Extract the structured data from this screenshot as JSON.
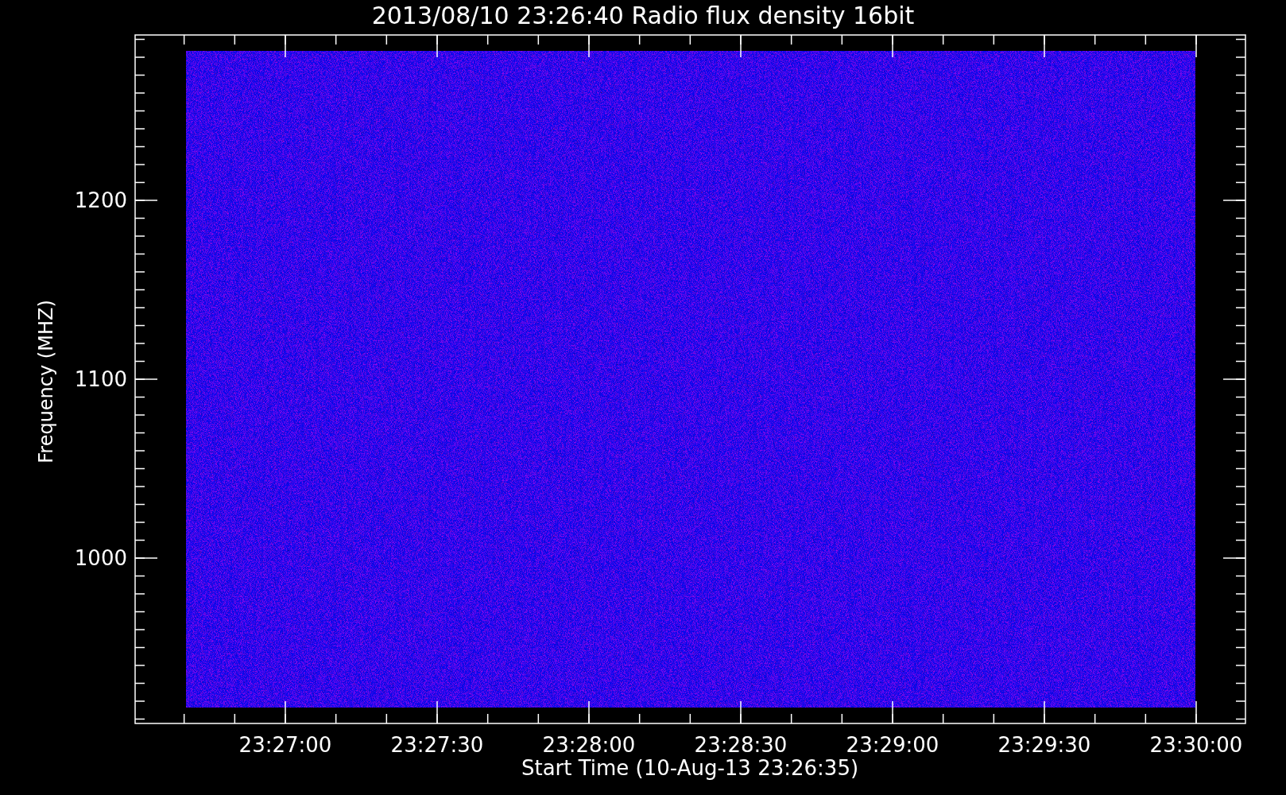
{
  "title": "2013/08/10 23:26:40 Radio flux density 16bit",
  "y_axis": {
    "label": "Frequency (MHZ)",
    "ticks": [
      "1200",
      "1100",
      "1000"
    ]
  },
  "x_axis": {
    "label": "Start Time (10-Aug-13 23:26:35)",
    "ticks": [
      "23:27:00",
      "23:27:30",
      "23:28:00",
      "23:28:30",
      "23:29:00",
      "23:29:30",
      "23:30:00"
    ]
  }
}
